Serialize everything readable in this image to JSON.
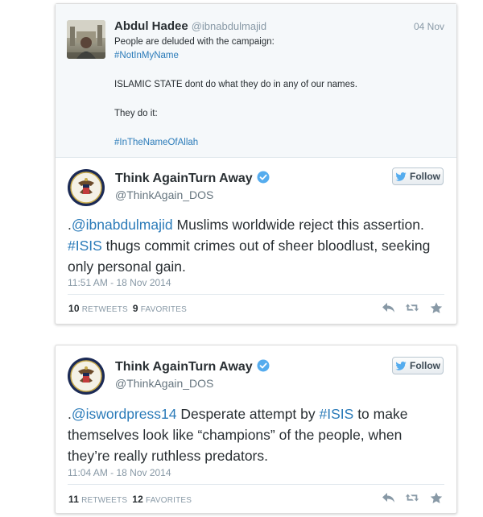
{
  "parent_tweet": {
    "name": "Abdul Hadee",
    "handle": "@ibnabdulmajid",
    "date": "04 Nov",
    "lines": [
      {
        "text": "People are deluded with the campaign:",
        "tag": false
      },
      {
        "text": "#NotInMyName",
        "tag": true
      },
      {
        "text": "ISLAMIC STATE dont do what they do in any of our names.",
        "tag": false
      },
      {
        "text": "They do it:",
        "tag": false
      },
      {
        "text": "#InTheNameOfAllah",
        "tag": true
      }
    ]
  },
  "tweets": [
    {
      "author": "Think AgainTurn Away",
      "handle": "@ThinkAgain_DOS",
      "follow_label": "Follow",
      "text_parts": [
        {
          "t": ".",
          "link": false
        },
        {
          "t": "@ibnabdulmajid",
          "link": true
        },
        {
          "t": " Muslims worldwide reject this assertion. ",
          "link": false
        },
        {
          "t": "#ISIS",
          "link": true
        },
        {
          "t": " thugs commit crimes out of sheer bloodlust, seeking only personal gain.",
          "link": false
        }
      ],
      "timestamp": "11:51 AM - 18 Nov 2014",
      "retweets": "10",
      "retweets_label": "RETWEETS",
      "favorites": "9",
      "favorites_label": "FAVORITES"
    },
    {
      "author": "Think AgainTurn Away",
      "handle": "@ThinkAgain_DOS",
      "follow_label": "Follow",
      "text_parts": [
        {
          "t": ".",
          "link": false
        },
        {
          "t": "@iswordpress14",
          "link": true
        },
        {
          "t": " Desperate attempt by ",
          "link": false
        },
        {
          "t": "#ISIS",
          "link": true
        },
        {
          "t": " to make themselves look like “champions” of the people, when they’re really ruthless predators.",
          "link": false
        }
      ],
      "timestamp": "11:04 AM - 18 Nov 2014",
      "retweets": "11",
      "retweets_label": "RETWEETS",
      "favorites": "12",
      "favorites_label": "FAVORITES"
    }
  ],
  "icons": {
    "verified": "verified-badge-icon",
    "twitter_bird": "twitter-bird-icon",
    "reply": "reply-icon",
    "retweet": "retweet-icon",
    "favorite": "star-icon",
    "seal": "state-department-seal"
  },
  "colors": {
    "link": "#2b7bb9",
    "verified": "#55acee",
    "muted": "#8899a6",
    "twitter_blue": "#55acee"
  }
}
